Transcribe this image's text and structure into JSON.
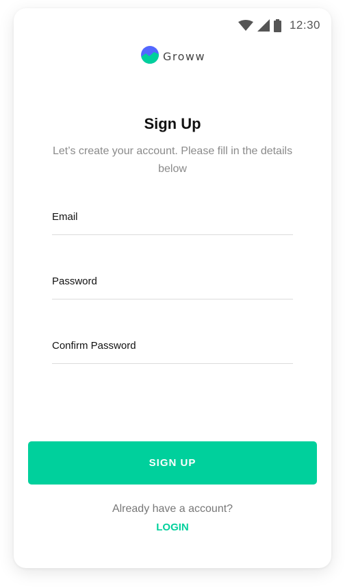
{
  "status_bar": {
    "time": "12:30",
    "icons": [
      "wifi-icon",
      "signal-icon",
      "battery-icon"
    ]
  },
  "brand": {
    "name": "Groww",
    "accent_color": "#00d09c",
    "logo_colors": [
      "#5367ff",
      "#00d09c"
    ]
  },
  "header": {
    "title": "Sign Up",
    "subtitle": "Let’s create your account. Please fill in the details below"
  },
  "form": {
    "fields": [
      {
        "label": "Email",
        "value": ""
      },
      {
        "label": "Password",
        "value": ""
      },
      {
        "label": "Confirm Password",
        "value": ""
      }
    ],
    "submit_label": "SIGN UP"
  },
  "footer": {
    "prompt": "Already have a account?",
    "login_label": "LOGIN"
  }
}
